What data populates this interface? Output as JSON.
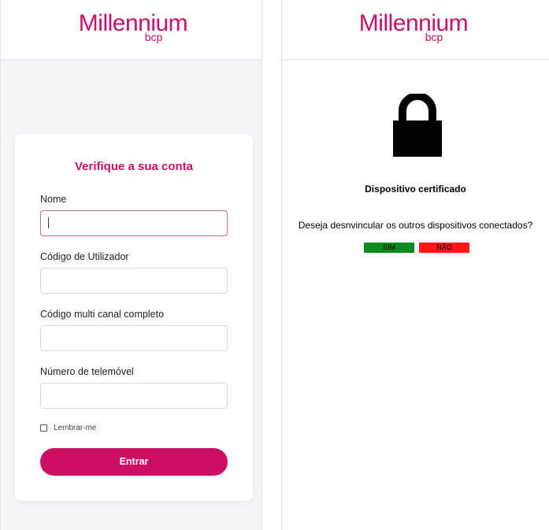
{
  "left_panel": {
    "logo": {
      "brand": "Millennium",
      "sub": "bcp"
    },
    "card_title": "Verifique a sua conta",
    "fields": [
      {
        "label": "Nome",
        "value": "",
        "placeholder": ""
      },
      {
        "label": "Código de Utilizador",
        "value": "",
        "placeholder": ""
      },
      {
        "label": "Código multi canal completo",
        "value": "",
        "placeholder": ""
      },
      {
        "label": "Número de telemóvel",
        "value": "",
        "placeholder": ""
      }
    ],
    "remember_label": "Lembrar-me",
    "submit_label": "Entrar"
  },
  "right_panel": {
    "logo": {
      "brand": "Millennium",
      "sub": "bcp"
    },
    "lock_icon": "lock-icon",
    "title": "Dispositivo certificado",
    "question": "Deseja desnvincular os outros dispositivos conectados?",
    "yes_label": "SIM",
    "no_label": "NÃO"
  },
  "colors": {
    "brand": "#c80f6a",
    "submit": "#cc0f62",
    "yes": "#0b8a1d",
    "no": "#ff1616"
  }
}
